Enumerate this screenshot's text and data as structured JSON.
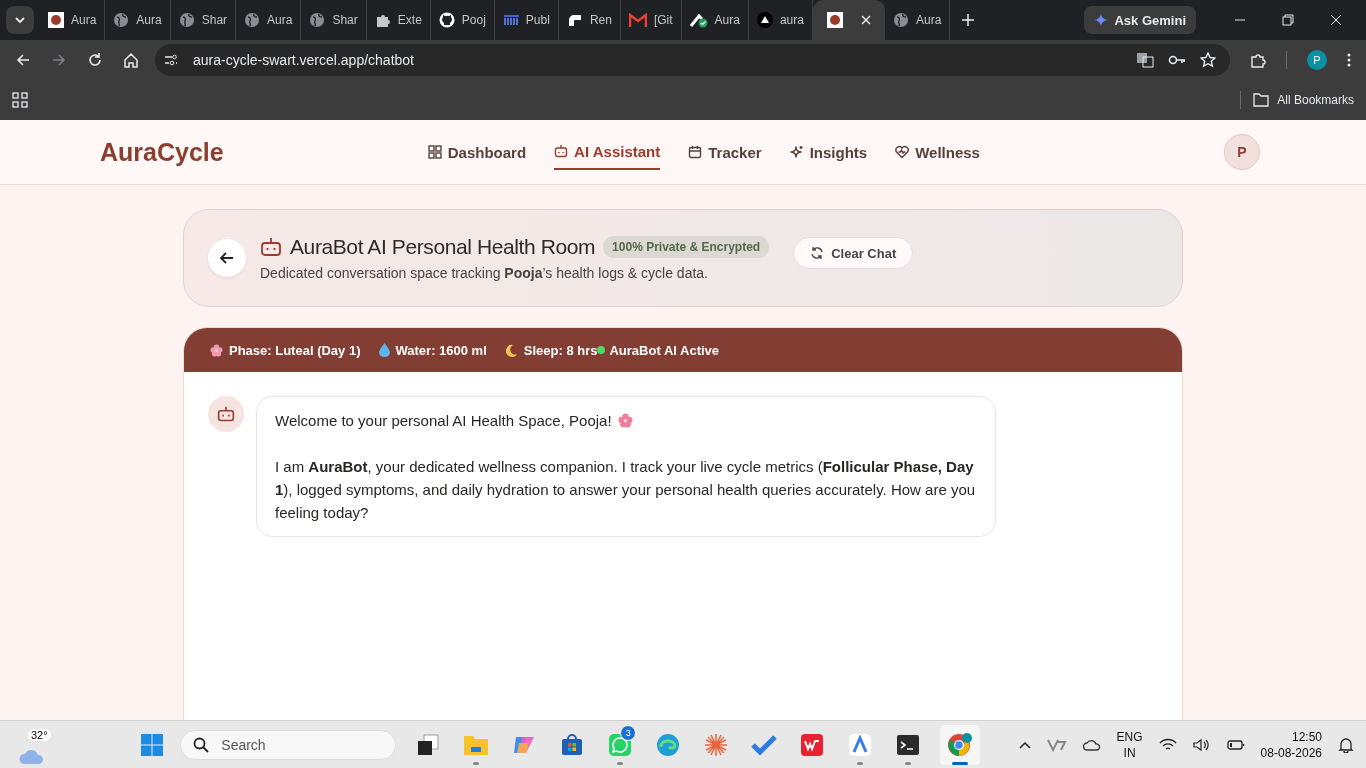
{
  "browser": {
    "tabs": [
      {
        "kind": "app",
        "title": "Aura",
        "selected": false
      },
      {
        "kind": "globe",
        "title": "Aura",
        "selected": false
      },
      {
        "kind": "globe",
        "title": "Shar",
        "selected": false
      },
      {
        "kind": "globe",
        "title": "Aura",
        "selected": false
      },
      {
        "kind": "globe",
        "title": "Shar",
        "selected": false
      },
      {
        "kind": "puzzle",
        "title": "Exte",
        "selected": false
      },
      {
        "kind": "github",
        "title": "Pooj",
        "selected": false
      },
      {
        "kind": "bars",
        "title": "Publ",
        "selected": false
      },
      {
        "kind": "render",
        "title": "Ren",
        "selected": false
      },
      {
        "kind": "mail",
        "title": "[Git",
        "selected": false
      },
      {
        "kind": "check",
        "title": "Aura",
        "selected": false
      },
      {
        "kind": "triangle",
        "title": "aura",
        "selected": false
      },
      {
        "kind": "app",
        "selected": true
      },
      {
        "kind": "globe",
        "title": "Aura",
        "selected": false
      }
    ],
    "ask_gemini": "Ask Gemini",
    "url": "aura-cycle-swart.vercel.app/chatbot",
    "profile": "P",
    "bookmarks": "All Bookmarks"
  },
  "app": {
    "logo": "AuraCycle",
    "nav": [
      {
        "kind": "grid",
        "label": "Dashboard",
        "selected": false
      },
      {
        "kind": "bot",
        "label": "AI Assistant",
        "selected": true
      },
      {
        "kind": "calendar",
        "label": "Tracker",
        "selected": false
      },
      {
        "kind": "sparkle",
        "label": "Insights",
        "selected": false
      },
      {
        "kind": "heart",
        "label": "Wellness",
        "selected": false
      }
    ],
    "avatar": "P"
  },
  "room": {
    "title": "AuraBot AI Personal Health Room",
    "badge": "100% Private & Encrypted",
    "subtitle": "Dedicated conversation space tracking **Pooja**’s health logs & cycle data.",
    "clear_button": "Clear Chat"
  },
  "status": [
    {
      "kind": "phase",
      "text": "Phase: Luteal (Day 1)"
    },
    {
      "kind": "water",
      "text": "Water: 1600 ml"
    },
    {
      "kind": "sleep",
      "text": "Sleep: 8 hrs"
    },
    {
      "kind": "active",
      "text": "AuraBot AI Active"
    }
  ],
  "messages": [
    {
      "paragraphs": [
        "Welcome to your personal AI Health Space, Pooja!",
        "I am **AuraBot**, your dedicated wellness companion. I track your live cycle metrics (**Follicular Phase, Day 1**), logged symptoms, and daily hydration to answer your personal health queries accurately. How are you feeling today?"
      ]
    }
  ],
  "taskbar": {
    "weather": "32°",
    "search": "Search",
    "apps": [
      {
        "kind": "taskview",
        "running": false,
        "selected": false
      },
      {
        "kind": "folder",
        "running": true,
        "selected": false
      },
      {
        "kind": "copilot",
        "running": false,
        "selected": false
      },
      {
        "kind": "store",
        "running": false,
        "selected": false
      },
      {
        "kind": "chat",
        "running": true,
        "selected": false,
        "badge": "3"
      },
      {
        "kind": "edge",
        "running": false,
        "selected": false
      },
      {
        "kind": "burst",
        "running": false,
        "selected": false
      },
      {
        "kind": "todo",
        "running": false,
        "selected": false
      },
      {
        "kind": "office",
        "running": false,
        "selected": false
      },
      {
        "kind": "letter",
        "running": true,
        "selected": false
      },
      {
        "kind": "terminal",
        "running": true,
        "selected": false
      },
      {
        "kind": "chrome",
        "running": true,
        "selected": true
      }
    ],
    "lang": "ENG",
    "region": "IN",
    "time": "12:50",
    "date": "08-08-2026"
  }
}
